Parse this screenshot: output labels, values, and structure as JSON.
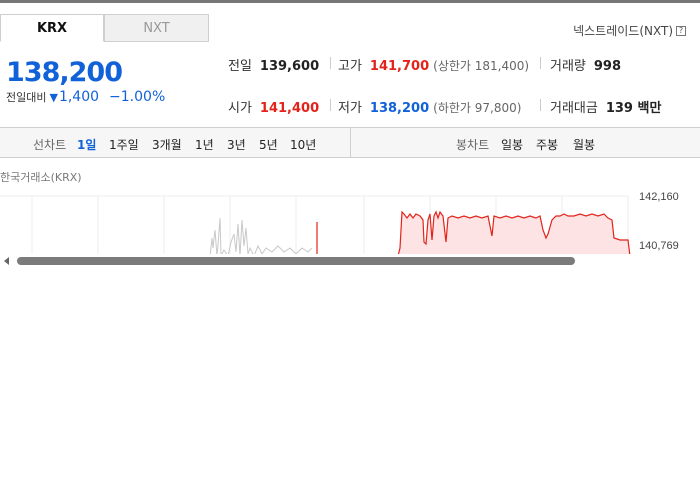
{
  "tabs": [
    {
      "label": "KRX"
    },
    {
      "label": "NXT"
    }
  ],
  "nxt_link": "넥스트레이드(NXT)",
  "help_icon": "?",
  "price": {
    "current": "138,200",
    "change_label": "전일대비",
    "change_value": "1,400",
    "change_pct": "−1.00%",
    "change_direction_icon": "down-triangle-icon"
  },
  "stats": {
    "prev_close": {
      "label": "전일",
      "value": "139,600"
    },
    "high": {
      "label": "고가",
      "value": "141,700",
      "limit": "(상한가 181,400)"
    },
    "volume": {
      "label": "거래량",
      "value": "998"
    },
    "open": {
      "label": "시가",
      "value": "141,400"
    },
    "low": {
      "label": "저가",
      "value": "138,200",
      "limit": "(하한가 97,800)"
    },
    "amount": {
      "label": "거래대금",
      "value": "139 백만"
    }
  },
  "toolbar": {
    "line_chart_label": "선차트",
    "line_periods": [
      "1일",
      "1주일",
      "3개월",
      "1년",
      "3년",
      "5년",
      "10년"
    ],
    "active_period": "1일",
    "candle_label": "봉차트",
    "candle_periods": [
      "일봉",
      "주봉",
      "월봉"
    ]
  },
  "chart": {
    "exchange_label": "한국거래소(KRX)",
    "y_ticks": [
      "142,160",
      "140,769"
    ]
  },
  "colors": {
    "up": "#e2231a",
    "down": "#1161d8",
    "area_fill": "#fde3e3"
  }
}
